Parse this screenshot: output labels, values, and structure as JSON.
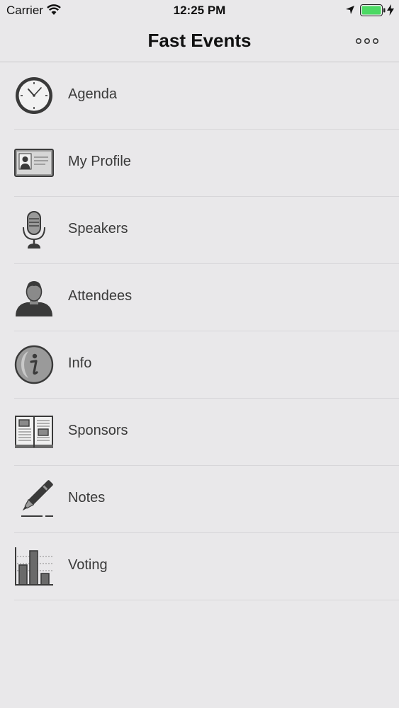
{
  "status_bar": {
    "carrier": "Carrier",
    "time": "12:25 PM",
    "battery_color": "#4cd964"
  },
  "nav": {
    "title": "Fast Events",
    "more_icon": "more-icon"
  },
  "menu": {
    "items": [
      {
        "label": "Agenda",
        "icon": "clock-icon"
      },
      {
        "label": "My Profile",
        "icon": "id-card-icon"
      },
      {
        "label": "Speakers",
        "icon": "microphone-icon"
      },
      {
        "label": "Attendees",
        "icon": "person-icon"
      },
      {
        "label": "Info",
        "icon": "info-icon"
      },
      {
        "label": "Sponsors",
        "icon": "open-book-icon"
      },
      {
        "label": "Notes",
        "icon": "pen-icon"
      },
      {
        "label": "Voting",
        "icon": "bar-chart-icon"
      }
    ]
  }
}
